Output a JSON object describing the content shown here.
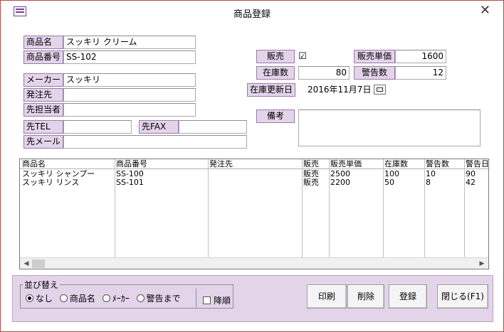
{
  "window": {
    "title": "商品登録",
    "close_glyph": "✕",
    "icon": "form-icon"
  },
  "form": {
    "product_name": {
      "label": "商品名",
      "value": "スッキリ クリーム"
    },
    "product_code": {
      "label": "商品番号",
      "value": "SS-102"
    },
    "maker": {
      "label": "メーカー",
      "value": "スッキリ"
    },
    "supplier": {
      "label": "発注先",
      "value": ""
    },
    "supplier_contact": {
      "label": "先担当者",
      "value": ""
    },
    "supplier_tel": {
      "label": "先TEL",
      "value": ""
    },
    "supplier_fax": {
      "label": "先FAX",
      "value": ""
    },
    "supplier_mail": {
      "label": "先メール",
      "value": ""
    },
    "sales": {
      "label": "販売",
      "check": "☑"
    },
    "unit_price": {
      "label": "販売単価",
      "value": "1600"
    },
    "stock": {
      "label": "在庫数",
      "value": "80"
    },
    "warning": {
      "label": "警告数",
      "value": "12"
    },
    "stock_updated": {
      "label": "在庫更新日",
      "value": "2016年11月7日"
    },
    "memo": {
      "label": "備考",
      "value": ""
    }
  },
  "list": {
    "headers": [
      "商品名",
      "商品番号",
      "発注先",
      "販売",
      "販売単価",
      "在庫数",
      "警告数",
      "警告日"
    ],
    "rows": [
      [
        "スッキリ シャンプー",
        "SS-100",
        "",
        "販売",
        "2500",
        "100",
        "10",
        "90"
      ],
      [
        "スッキリ リンス",
        "SS-101",
        "",
        "販売",
        "2200",
        "50",
        "8",
        "42"
      ]
    ],
    "scroll_left": "◀",
    "scroll_right": "▶"
  },
  "sort": {
    "title": "並び替え",
    "options": [
      "なし",
      "商品名",
      "ﾒｰｶｰ",
      "警告まで"
    ],
    "selected": "なし",
    "desc_label": "降順"
  },
  "buttons": {
    "print": "印刷",
    "delete": "削除",
    "register": "登録",
    "close": "閉じる(F1)"
  }
}
